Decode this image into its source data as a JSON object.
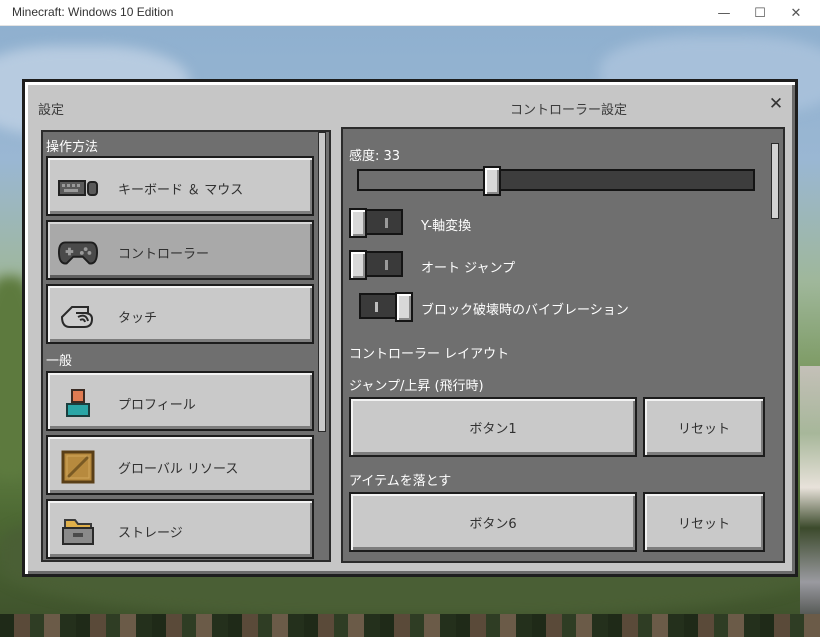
{
  "window": {
    "title": "Minecraft: Windows 10 Edition",
    "min_glyph": "—",
    "max_glyph": "☐",
    "close_glyph": "✕"
  },
  "header": {
    "left_title": "設定",
    "center_title": "コントローラー設定",
    "close_glyph": "✕"
  },
  "sidebar": {
    "section1": "操作方法",
    "section2": "一般",
    "items": [
      {
        "label": "キーボード ＆ マウス",
        "icon": "keyboard-mouse-icon",
        "selected": false
      },
      {
        "label": "コントローラー",
        "icon": "gamepad-icon",
        "selected": true
      },
      {
        "label": "タッチ",
        "icon": "touch-hand-icon",
        "selected": false
      },
      {
        "label": "プロフィール",
        "icon": "profile-icon",
        "selected": false
      },
      {
        "label": "グローバル リソース",
        "icon": "crate-icon",
        "selected": false
      },
      {
        "label": "ストレージ",
        "icon": "storage-folder-icon",
        "selected": false
      }
    ]
  },
  "controller": {
    "sensitivity_label": "感度: 33",
    "sensitivity_value": 33,
    "invert_y": {
      "label": "Y-軸変換",
      "on": false
    },
    "auto_jump": {
      "label": "オート ジャンプ",
      "on": false
    },
    "vibration": {
      "label": "ブロック破壊時のバイブレーション",
      "on": true
    },
    "layout_label": "コントローラー レイアウト",
    "jump": {
      "label": "ジャンプ/上昇 (飛行時)",
      "binding": "ボタン1",
      "reset": "リセット"
    },
    "drop": {
      "label": "アイテムを落とす",
      "binding": "ボタン6",
      "reset": "リセット"
    }
  }
}
